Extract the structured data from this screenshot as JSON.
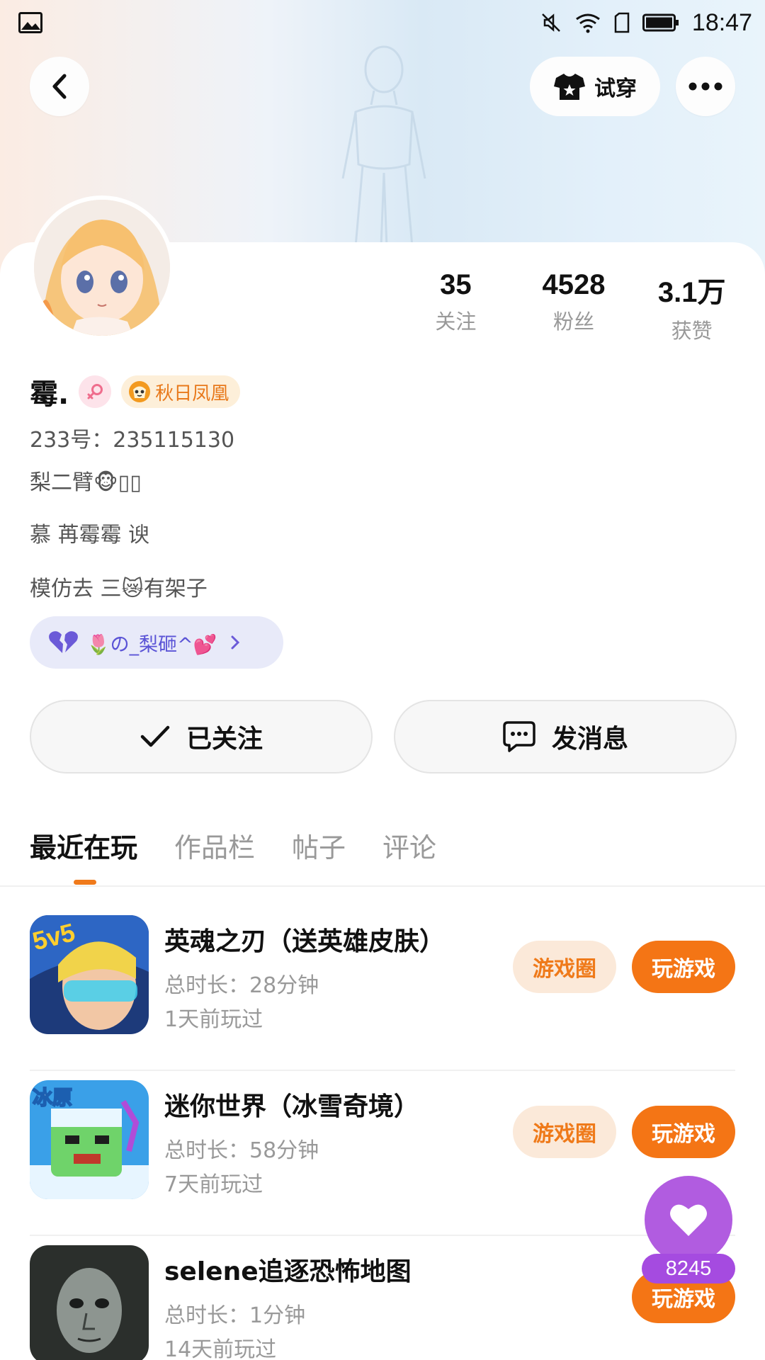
{
  "status_bar": {
    "time": "18:47"
  },
  "header": {
    "try_on_label": "试穿"
  },
  "stats": [
    {
      "value": "35",
      "label": "关注"
    },
    {
      "value": "4528",
      "label": "粉丝"
    },
    {
      "value": "3.1万",
      "label": "获赞"
    }
  ],
  "profile": {
    "name": "霉.",
    "title_badge": "秋日凤凰",
    "id_line": "233号：235115130",
    "bio_lines": [
      "梨二臂🐵▯▯",
      "慕 苒霉霉 谀",
      "模仿去 三😿有架子"
    ]
  },
  "group_pill": {
    "label": "🌷の_梨砸^💕"
  },
  "actions": {
    "followed_label": "已关注",
    "message_label": "发消息"
  },
  "tabs": [
    "最近在玩",
    "作品栏",
    "帖子",
    "评论"
  ],
  "games": [
    {
      "title": "英魂之刃（送英雄皮肤）",
      "duration": "总时长：28分钟",
      "last_played": "1天前玩过",
      "has_circle": true
    },
    {
      "title": "迷你世界（冰雪奇境）",
      "duration": "总时长：58分钟",
      "last_played": "7天前玩过",
      "has_circle": true
    },
    {
      "title": "selene追逐恐怖地图",
      "duration": "总时长：1分钟",
      "last_played": "14天前玩过",
      "has_circle": false
    }
  ],
  "game_buttons": {
    "circle_label": "游戏圈",
    "play_label": "玩游戏"
  },
  "like_float": {
    "count": "8245"
  },
  "colors": {
    "accent": "#f47515",
    "like": "#b15ce0",
    "group": "#5a53d6"
  }
}
